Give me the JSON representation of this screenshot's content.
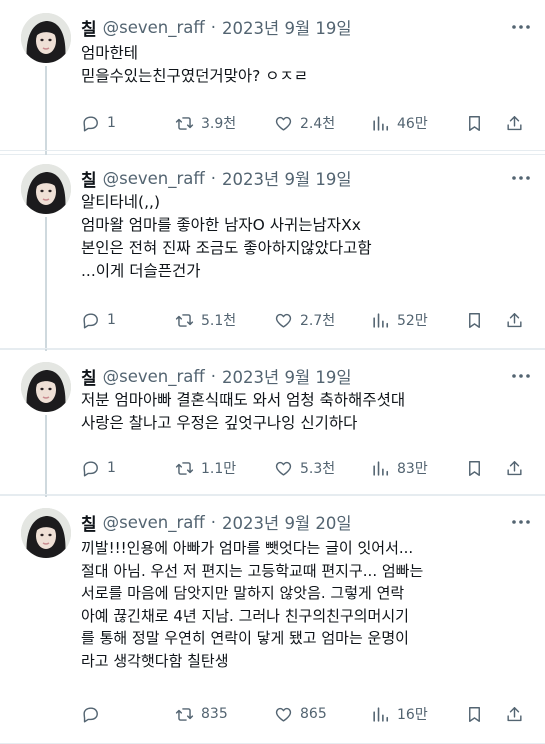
{
  "tweets": [
    {
      "name": "칠",
      "handle": "@seven_raff",
      "separator": "·",
      "date": "2023년 9월 19일",
      "text": "엄마한테\n믿을수있는친구였던거맞아? ㅇㅈㄹ",
      "replies": "1",
      "retweets": "3.9천",
      "likes": "2.4천",
      "views": "46만"
    },
    {
      "name": "칠",
      "handle": "@seven_raff",
      "separator": "·",
      "date": "2023년 9월 19일",
      "text": "알티타네(,,)\n엄마왈 엄마를 좋아한 남자O 사귀는남자Xx\n본인은 전혀 진짜 조금도 좋아하지않았다고함\n...이게 더슬픈건가",
      "replies": "1",
      "retweets": "5.1천",
      "likes": "2.7천",
      "views": "52만"
    },
    {
      "name": "칠",
      "handle": "@seven_raff",
      "separator": "·",
      "date": "2023년 9월 19일",
      "text": "저분 엄마아빠 결혼식때도 와서 엄청 축하해주셧대\n사랑은 찰나고 우정은 깊엇구나잉 신기하다",
      "replies": "1",
      "retweets": "1.1만",
      "likes": "5.3천",
      "views": "83만"
    },
    {
      "name": "칠",
      "handle": "@seven_raff",
      "separator": "·",
      "date": "2023년 9월 20일",
      "text": "끼발!!!인용에 아빠가 엄마를 뺏엇다는 글이 잇어서...\n절대 아님. 우선 저 편지는 고등학교때 편지구... 엄빠는\n서로를 마음에 담앗지만 말하지 않앗음. 그렇게 연락\n아예 끊긴채로 4년 지남. 그러나 친구의친구의머시기\n를 통해 정말 우연히 연락이 닿게 됐고 엄마는 운명이\n라고 생각햇다함 칠탄생",
      "replies": "",
      "retweets": "835",
      "likes": "865",
      "views": "16만"
    }
  ],
  "icons": {
    "reply": "reply-icon",
    "retweet": "retweet-icon",
    "like": "heart-icon",
    "views": "views-icon",
    "bookmark": "bookmark-icon",
    "share": "share-icon",
    "more": "more-icon"
  },
  "colors": {
    "text": "#0f1419",
    "muted": "#536471",
    "divider": "#e6ecf0",
    "thread_line": "#cfd9de"
  }
}
